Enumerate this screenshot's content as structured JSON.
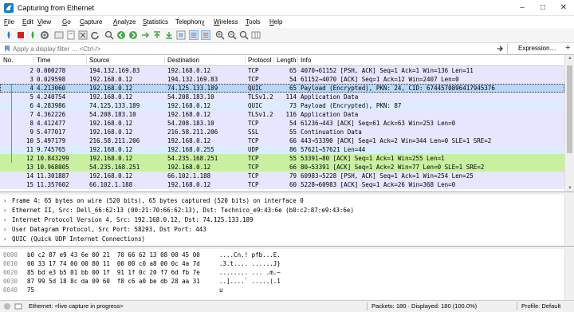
{
  "window": {
    "title": "Capturing from Ethernet"
  },
  "menu": [
    {
      "pre": "",
      "u": "F",
      "post": "ile"
    },
    {
      "pre": "",
      "u": "E",
      "post": "dit"
    },
    {
      "pre": "",
      "u": "V",
      "post": "iew"
    },
    {
      "pre": "",
      "u": "G",
      "post": "o"
    },
    {
      "pre": "",
      "u": "C",
      "post": "apture"
    },
    {
      "pre": "",
      "u": "A",
      "post": "nalyze"
    },
    {
      "pre": "",
      "u": "S",
      "post": "tatistics"
    },
    {
      "pre": "Telephon",
      "u": "y",
      "post": ""
    },
    {
      "pre": "",
      "u": "W",
      "post": "ireless"
    },
    {
      "pre": "",
      "u": "T",
      "post": "ools"
    },
    {
      "pre": "",
      "u": "H",
      "post": "elp"
    }
  ],
  "filter": {
    "placeholder": "Apply a display filter … <Ctrl-/>",
    "expression_label": "Expression…",
    "plus": "+"
  },
  "columns": [
    "No.",
    "Time",
    "Source",
    "Destination",
    "Protocol",
    "Length",
    "Info"
  ],
  "packets": [
    {
      "no": "2",
      "time": "0.000278",
      "src": "194.132.169.83",
      "dst": "192.168.0.12",
      "proto": "TCP",
      "len": "65",
      "info": "4070→61152 [PSH, ACK] Seq=1 Ack=1 Win=136 Len=11",
      "bg": "#e7e6ff"
    },
    {
      "no": "3",
      "time": "0.029598",
      "src": "192.168.0.12",
      "dst": "194.132.169.83",
      "proto": "TCP",
      "len": "54",
      "info": "61152→4070 [ACK] Seq=1 Ack=12 Win=2407 Len=0",
      "bg": "#e7e6ff"
    },
    {
      "no": "4",
      "time": "4.213060",
      "src": "192.168.0.12",
      "dst": "74.125.133.189",
      "proto": "QUIC",
      "len": "65",
      "info": "Payload (Encrypted), PKN: 24, CID: 6744570896417945376",
      "bg": "#cce6ff"
    },
    {
      "no": "5",
      "time": "4.240754",
      "src": "192.168.0.12",
      "dst": "54.208.183.10",
      "proto": "TLSv1.2",
      "len": "114",
      "info": "Application Data",
      "bg": "#e7e6ff"
    },
    {
      "no": "6",
      "time": "4.283986",
      "src": "74.125.133.189",
      "dst": "192.168.0.12",
      "proto": "QUIC",
      "len": "73",
      "info": "Payload (Encrypted), PKN: 87",
      "bg": "#daeeff"
    },
    {
      "no": "7",
      "time": "4.362226",
      "src": "54.208.183.10",
      "dst": "192.168.0.12",
      "proto": "TLSv1.2",
      "len": "116",
      "info": "Application Data",
      "bg": "#e7e6ff"
    },
    {
      "no": "8",
      "time": "4.412477",
      "src": "192.168.0.12",
      "dst": "54.208.183.10",
      "proto": "TCP",
      "len": "54",
      "info": "61236→443 [ACK] Seq=61 Ack=63 Win=253 Len=0",
      "bg": "#e7e6ff"
    },
    {
      "no": "9",
      "time": "5.477017",
      "src": "192.168.0.12",
      "dst": "216.58.211.206",
      "proto": "SSL",
      "len": "55",
      "info": "Continuation Data",
      "bg": "#e7e6ff"
    },
    {
      "no": "10",
      "time": "5.497179",
      "src": "216.58.211.206",
      "dst": "192.168.0.12",
      "proto": "TCP",
      "len": "66",
      "info": "443→53390 [ACK] Seq=1 Ack=2 Win=344 Len=0 SLE=1 SRE=2",
      "bg": "#e7e6ff"
    },
    {
      "no": "11",
      "time": "9.745765",
      "src": "192.168.0.12",
      "dst": "192.168.0.255",
      "proto": "UDP",
      "len": "86",
      "info": "57621→57621 Len=44",
      "bg": "#daeeff"
    },
    {
      "no": "12",
      "time": "10.843299",
      "src": "192.168.0.12",
      "dst": "54.235.168.251",
      "proto": "TCP",
      "len": "55",
      "info": "53391→80 [ACK] Seq=1 Ack=1 Win=255 Len=1",
      "bg": "#c8f0a0"
    },
    {
      "no": "13",
      "time": "10.968005",
      "src": "54.235.168.251",
      "dst": "192.168.0.12",
      "proto": "TCP",
      "len": "66",
      "info": "80→53391 [ACK] Seq=1 Ack=2 Win=77 Len=0 SLE=1 SRE=2",
      "bg": "#c8f0a0"
    },
    {
      "no": "14",
      "time": "11.301887",
      "src": "192.168.0.12",
      "dst": "66.102.1.188",
      "proto": "TCP",
      "len": "79",
      "info": "60983→5228 [PSH, ACK] Seq=1 Ack=1 Win=254 Len=25",
      "bg": "#e7e6ff"
    },
    {
      "no": "15",
      "time": "11.357602",
      "src": "66.102.1.188",
      "dst": "192.168.0.12",
      "proto": "TCP",
      "len": "60",
      "info": "5228→60983 [ACK] Seq=1 Ack=26 Win=368 Len=0",
      "bg": "#e7e6ff"
    }
  ],
  "selected_packet": "4",
  "details": [
    "Frame 4: 65 bytes on wire (520 bits), 65 bytes captured (520 bits) on interface 0",
    "Ethernet II, Src: Dell_66:62:13 (00:21:70:66:62:13), Dst: Technico_e9:43:6e (b0:c2:87:e9:43:6e)",
    "Internet Protocol Version 4, Src: 192.168.0.12, Dst: 74.125.133.189",
    "User Datagram Protocol, Src Port: 58293, Dst Port: 443",
    "QUIC (Quick UDP Internet Connections)"
  ],
  "bytes": [
    {
      "off": "0000",
      "hex": "b0 c2 87 e9 43 6e 00 21  70 66 62 13 08 00 45 00",
      "ascii": "....Cn.! pfb...E."
    },
    {
      "off": "0010",
      "hex": "00 33 17 74 00 00 80 11  00 00 c0 a8 00 0c 4a 7d",
      "ascii": ".3.t.... ......J}"
    },
    {
      "off": "0020",
      "hex": "85 bd e3 b5 01 bb 00 1f  91 1f 0c 20 f7 6d fb 7e",
      "ascii": "........ ... .m.~"
    },
    {
      "off": "0030",
      "hex": "87 99 5d 18 8c da 09 60  f8 c6 a0 be db 28 aa 31",
      "ascii": "..]....` .....(.1"
    },
    {
      "off": "0040",
      "hex": "75",
      "ascii": "u"
    }
  ],
  "status": {
    "interface": "Ethernet: <live capture in progress>",
    "packets": "Packets: 180 · Displayed: 180 (100.0%)",
    "profile": "Profile: Default"
  }
}
